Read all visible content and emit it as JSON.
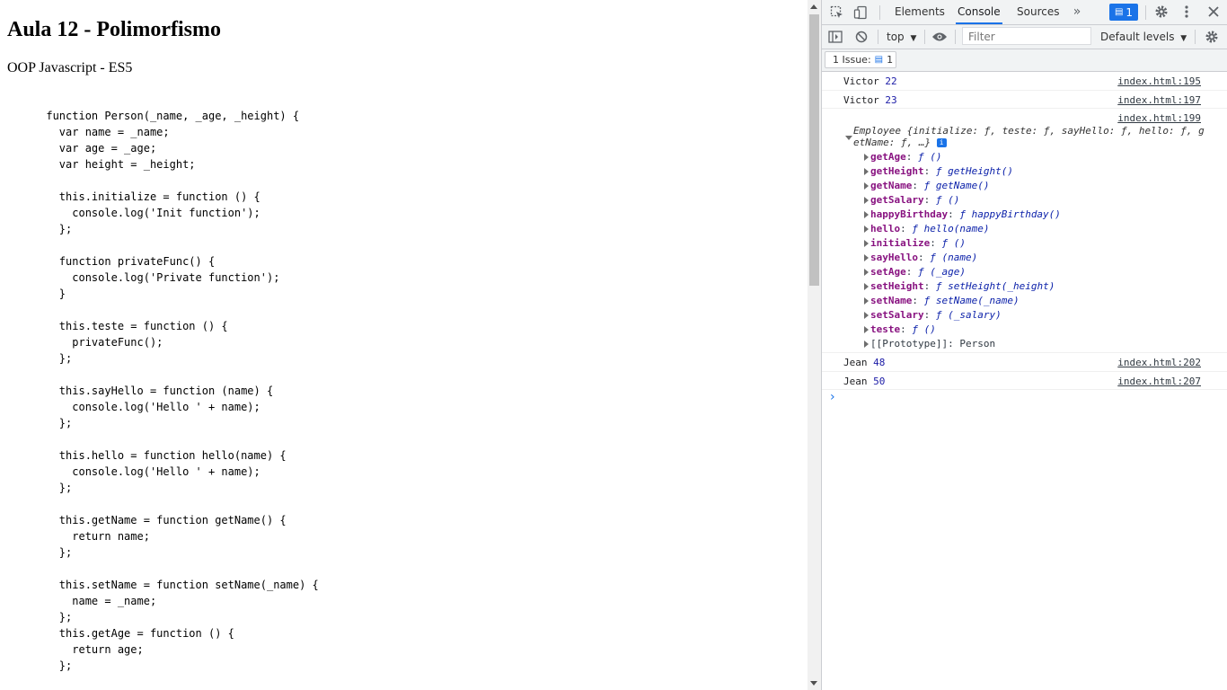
{
  "page": {
    "title": "Aula 12 - Polimorfismo",
    "subtitle": "OOP Javascript - ES5",
    "code": "      function Person(_name, _age, _height) {\n        var name = _name;\n        var age = _age;\n        var height = _height;\n\n        this.initialize = function () {\n          console.log('Init function');\n        };\n\n        function privateFunc() {\n          console.log('Private function');\n        }\n\n        this.teste = function () {\n          privateFunc();\n        };\n\n        this.sayHello = function (name) {\n          console.log('Hello ' + name);\n        };\n\n        this.hello = function hello(name) {\n          console.log('Hello ' + name);\n        };\n\n        this.getName = function getName() {\n          return name;\n        };\n\n        this.setName = function setName(_name) {\n          name = _name;\n        };\n        this.getAge = function () {\n          return age;\n        };"
  },
  "devtools": {
    "tabs": [
      {
        "label": "Elements",
        "active": false
      },
      {
        "label": "Console",
        "active": true
      },
      {
        "label": "Sources",
        "active": false
      }
    ],
    "more_tabs_icon": "chevron-double-right-icon",
    "issues_badge_count": "1",
    "context_selector": "top",
    "filter_placeholder": "Filter",
    "levels_label": "Default levels",
    "issues_label": "1 Issue:",
    "issues_count": "1",
    "accent_color": "#1a73e8"
  },
  "console": {
    "messages": [
      {
        "name": "Victor",
        "value": "22",
        "source": "index.html:195"
      },
      {
        "name": "Victor",
        "value": "23",
        "source": "index.html:197"
      }
    ],
    "object_source": "index.html:199",
    "object_header": "Employee {initialize: ƒ, teste: ƒ, sayHello: ƒ, hello: ƒ, getName: ƒ, …}",
    "object_props": [
      {
        "key": "getAge",
        "value": "ƒ ()"
      },
      {
        "key": "getHeight",
        "value": "ƒ getHeight()"
      },
      {
        "key": "getName",
        "value": "ƒ getName()"
      },
      {
        "key": "getSalary",
        "value": "ƒ ()"
      },
      {
        "key": "happyBirthday",
        "value": "ƒ happyBirthday()"
      },
      {
        "key": "hello",
        "value": "ƒ hello(name)"
      },
      {
        "key": "initialize",
        "value": "ƒ ()"
      },
      {
        "key": "sayHello",
        "value": "ƒ (name)"
      },
      {
        "key": "setAge",
        "value": "ƒ (_age)"
      },
      {
        "key": "setHeight",
        "value": "ƒ setHeight(_height)"
      },
      {
        "key": "setName",
        "value": "ƒ setName(_name)"
      },
      {
        "key": "setSalary",
        "value": "ƒ (_salary)"
      },
      {
        "key": "teste",
        "value": "ƒ ()"
      }
    ],
    "prototype_label": "[[Prototype]]: Person",
    "messages_after": [
      {
        "name": "Jean",
        "value": "48",
        "source": "index.html:202"
      },
      {
        "name": "Jean",
        "value": "50",
        "source": "index.html:207"
      }
    ],
    "prompt_symbol": "›"
  }
}
